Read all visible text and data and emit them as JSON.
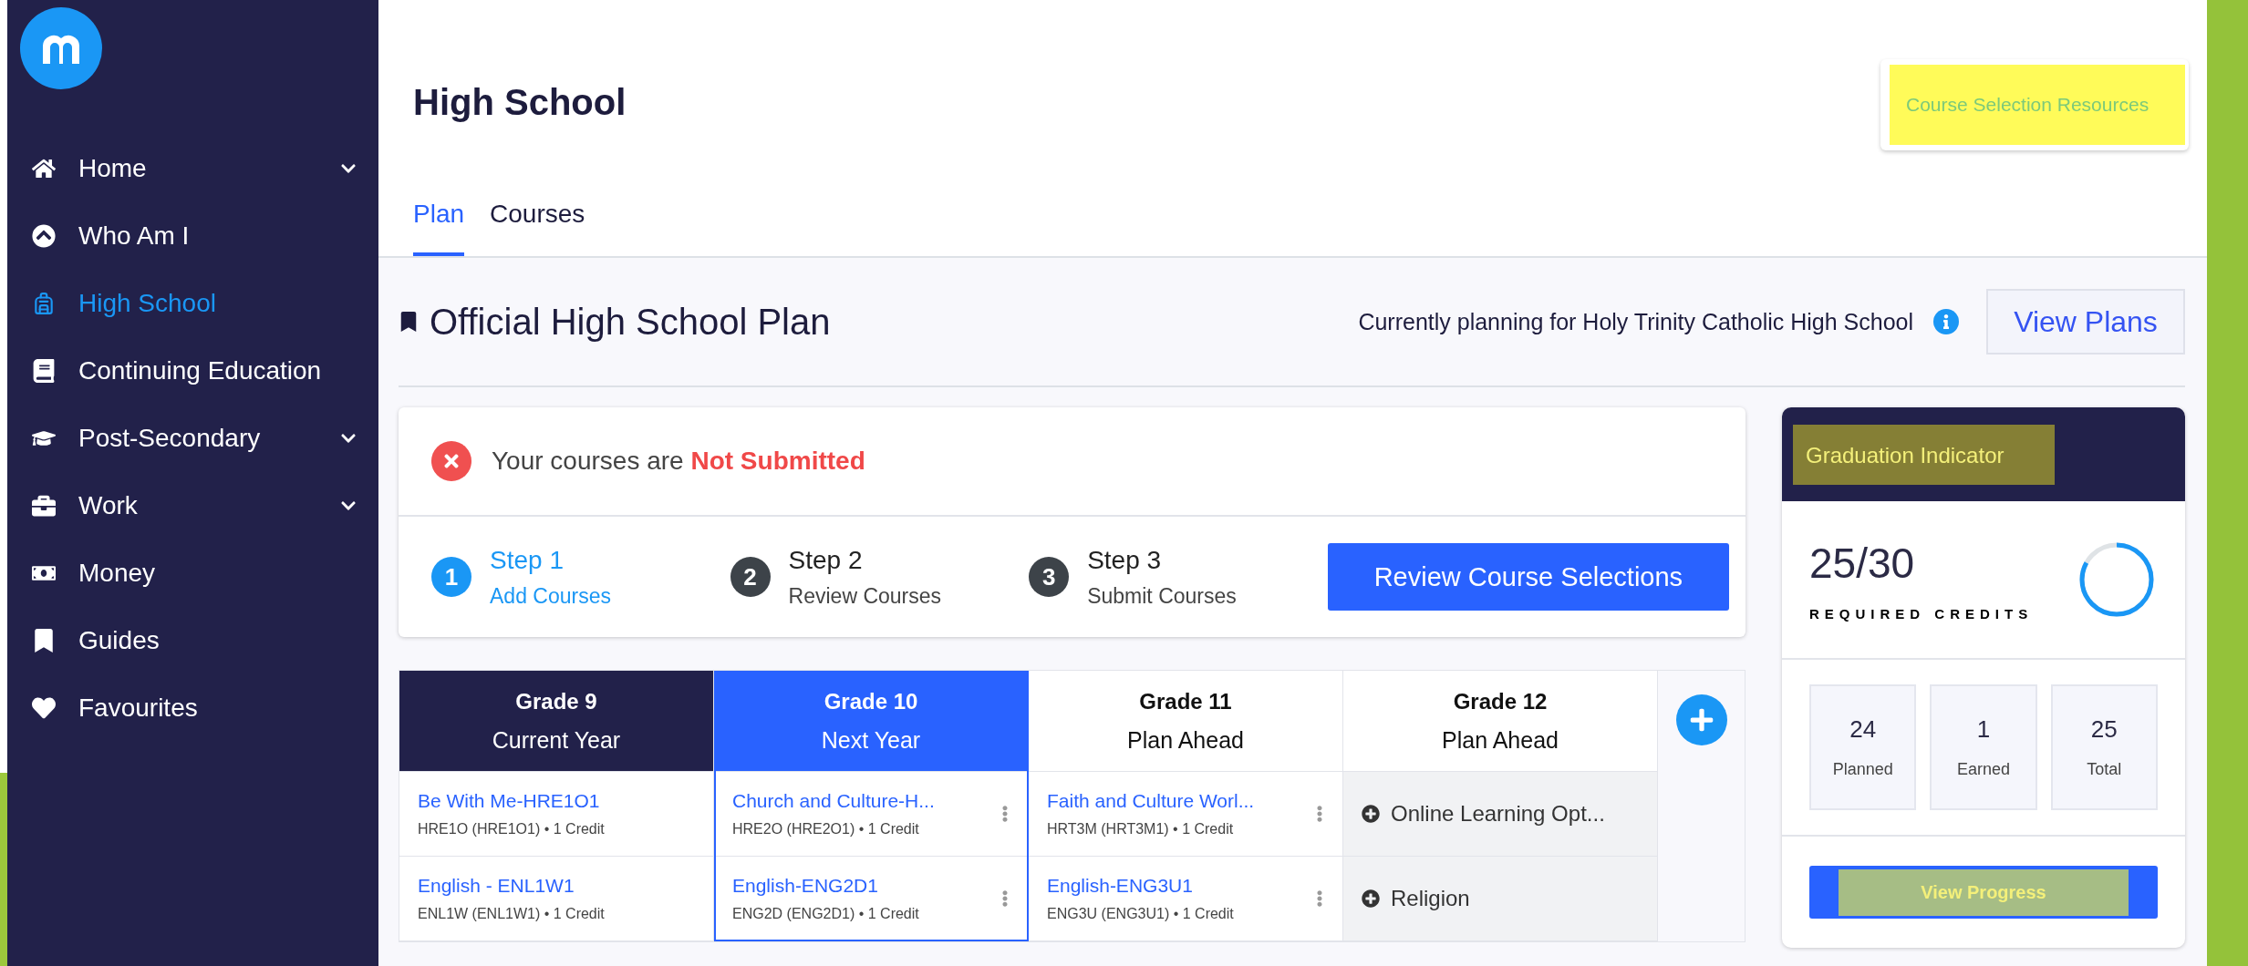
{
  "sidebar": {
    "items": [
      {
        "label": "Home",
        "selected": false,
        "submenu": true
      },
      {
        "label": "Who Am I",
        "selected": false,
        "submenu": false
      },
      {
        "label": "High School",
        "selected": true,
        "submenu": false
      },
      {
        "label": "Continuing Education",
        "selected": false,
        "submenu": false
      },
      {
        "label": "Post-Secondary",
        "selected": false,
        "submenu": true
      },
      {
        "label": "Work",
        "selected": false,
        "submenu": true
      },
      {
        "label": "Money",
        "selected": false,
        "submenu": false
      },
      {
        "label": "Guides",
        "selected": false,
        "submenu": false
      },
      {
        "label": "Favourites",
        "selected": false,
        "submenu": false
      }
    ]
  },
  "header": {
    "title": "High School",
    "resources_link": {
      "label": "Course Selection Resources",
      "highlighted": true
    }
  },
  "tabs": [
    {
      "label": "Plan",
      "selected": true
    },
    {
      "label": "Courses",
      "selected": false
    }
  ],
  "plan": {
    "title": "Official High School Plan",
    "planning_note": "Currently planning for Holy Trinity Catholic High School",
    "view_plans": "View Plans"
  },
  "status": {
    "text": "Your courses are **Not Submitted**",
    "steps": [
      {
        "number": "1",
        "title": "Step 1",
        "subtitle": "Add Courses",
        "active": true
      },
      {
        "number": "2",
        "title": "Step 2",
        "subtitle": "Review Courses",
        "active": false
      },
      {
        "number": "3",
        "title": "Step 3",
        "subtitle": "Submit Courses",
        "active": false
      }
    ],
    "review_button": "Review Course Selections"
  },
  "grades": [
    {
      "grade": "Grade 9",
      "label": "Current Year",
      "current": true,
      "selected": false,
      "cells": [
        {
          "kind": "course",
          "title": "Be With Me-HRE1O1",
          "detail": "HRE1O (HRE1O1) • 1 Credit",
          "menu": false
        },
        {
          "kind": "course",
          "title": "English - ENL1W1",
          "detail": "ENL1W (ENL1W1) • 1 Credit",
          "menu": false
        }
      ]
    },
    {
      "grade": "Grade 10",
      "label": "Next Year",
      "current": false,
      "selected": true,
      "cells": [
        {
          "kind": "course",
          "title": "Church and Culture-H...",
          "detail": "HRE2O (HRE2O1) • 1 Credit",
          "menu": true
        },
        {
          "kind": "course",
          "title": "English-ENG2D1",
          "detail": "ENG2D (ENG2D1) • 1 Credit",
          "menu": true
        }
      ]
    },
    {
      "grade": "Grade 11",
      "label": "Plan Ahead",
      "current": false,
      "selected": false,
      "cells": [
        {
          "kind": "course",
          "title": "Faith and Culture Worl...",
          "detail": "HRT3M (HRT3M1) • 1 Credit",
          "menu": true
        },
        {
          "kind": "course",
          "title": "English-ENG3U1",
          "detail": "ENG3U (ENG3U1) • 1 Credit",
          "menu": true
        }
      ]
    },
    {
      "grade": "Grade 12",
      "label": "Plan Ahead",
      "current": false,
      "selected": false,
      "cells": [
        {
          "kind": "option",
          "title": "Online Learning Opt..."
        },
        {
          "kind": "option",
          "title": "Religion"
        }
      ]
    }
  ],
  "graduation": {
    "title": "Graduation Indicator",
    "title_highlighted": true,
    "credits": "25/30",
    "credits_label": "REQUIRED CREDITS",
    "level": 0.83,
    "stats": [
      {
        "value": "24",
        "label": "Planned"
      },
      {
        "value": "1",
        "label": "Earned"
      },
      {
        "value": "25",
        "label": "Total"
      }
    ],
    "button": {
      "label": "View Progress",
      "highlighted": true
    }
  }
}
